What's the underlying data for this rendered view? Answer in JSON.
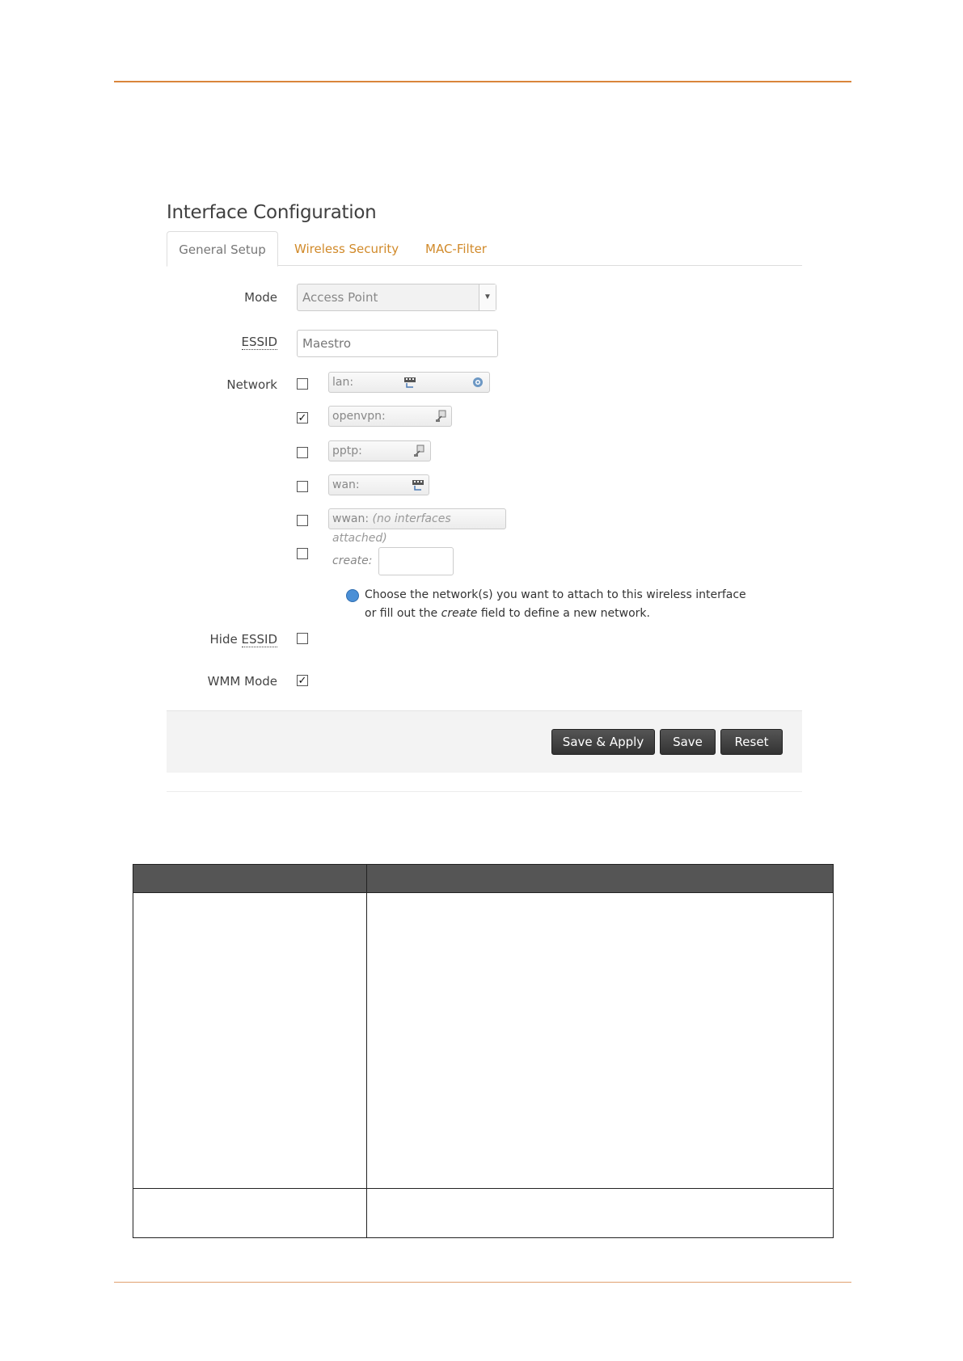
{
  "panel": {
    "title": "Interface Configuration"
  },
  "tabs": [
    {
      "label": "General Setup",
      "active": true
    },
    {
      "label": "Wireless Security",
      "active": false
    },
    {
      "label": "MAC-Filter",
      "active": false
    }
  ],
  "form": {
    "mode": {
      "label": "Mode",
      "value": "Access Point"
    },
    "essid": {
      "label": "ESSID",
      "value": "Maestro"
    },
    "network": {
      "label": "Network",
      "items": [
        {
          "name": "lan:",
          "checked": false,
          "icons": [
            "ethernet-icon",
            "wifi-icon"
          ]
        },
        {
          "name": "openvpn:",
          "checked": true,
          "icons": [
            "tunnel-icon"
          ]
        },
        {
          "name": "pptp:",
          "checked": false,
          "icons": [
            "tunnel-icon"
          ]
        },
        {
          "name": "wan:",
          "checked": false,
          "icons": [
            "ethernet-icon"
          ]
        },
        {
          "name": "wwan:",
          "note": "(no interfaces attached)",
          "checked": false,
          "icons": []
        }
      ],
      "create_label": "create:",
      "create_checked": false,
      "hint_line1": "Choose the network(s) you want to attach to this wireless interface",
      "hint_line2_pre": "or fill out the ",
      "hint_line2_em": "create",
      "hint_line2_post": " field to define a new network."
    },
    "hide_essid": {
      "label_pre": "Hide ",
      "label_abbr": "ESSID",
      "checked": false
    },
    "wmm_mode": {
      "label": "WMM Mode",
      "checked": true
    }
  },
  "actions": {
    "save_apply": "Save & Apply",
    "save": "Save",
    "reset": "Reset"
  },
  "colors": {
    "accent": "#d18a2a",
    "rule": "#d9853b",
    "button": "#444444",
    "table_header": "#555555"
  }
}
